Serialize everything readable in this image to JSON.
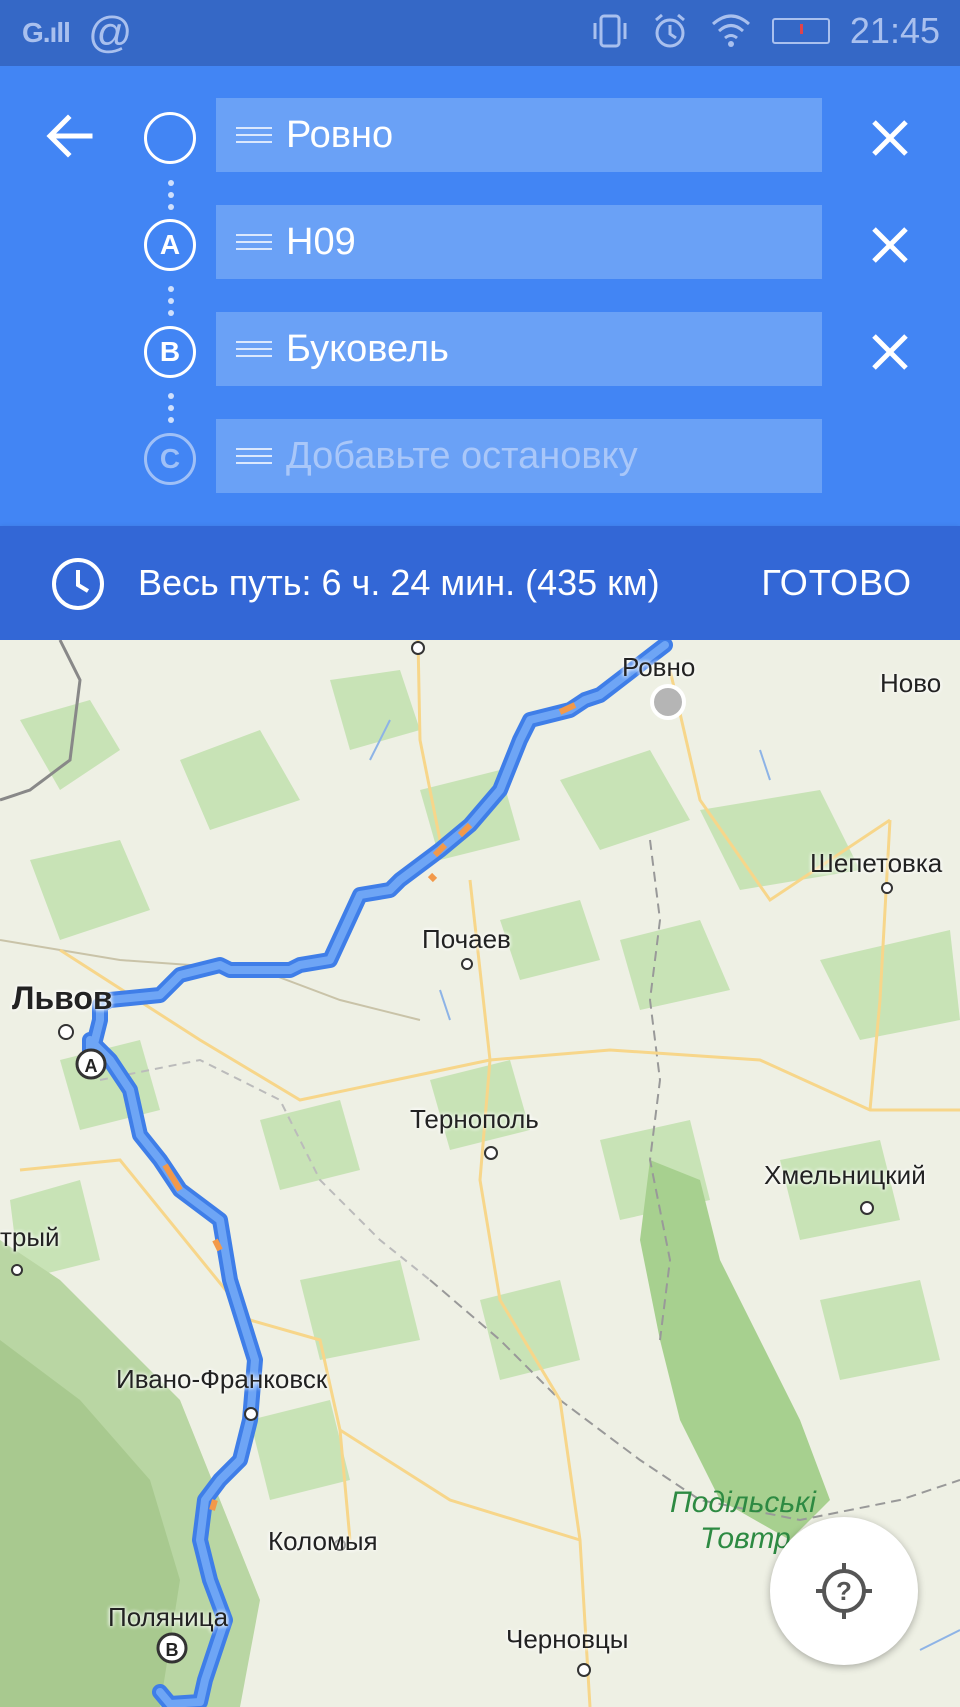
{
  "status_bar": {
    "signal": "G.ıll",
    "at_symbol": "@",
    "time": "21:45"
  },
  "route": {
    "stops": [
      {
        "marker": "",
        "value": "Ровно"
      },
      {
        "marker": "A",
        "value": "Н09"
      },
      {
        "marker": "B",
        "value": "Буковель"
      },
      {
        "marker": "C",
        "placeholder": "Добавьте остановку"
      }
    ]
  },
  "summary": {
    "text": "Весь путь: 6 ч. 24 мин.  (435 км)",
    "done_label": "ГОТОВО"
  },
  "map": {
    "cities": {
      "rovno": "Ровно",
      "novo": "Ново",
      "shepetovka": "Шепетовка",
      "pochaev": "Почаев",
      "lvov": "Львов",
      "ternopol": "Тернополь",
      "khmelnitsky": "Хмельницкий",
      "stryi": "трый",
      "ivano": "Ивано-Франковск",
      "kolomyya": "Коломыя",
      "polyanitsa": "Поляница",
      "chernovtsy": "Черновцы"
    },
    "region_line1": "Подільські",
    "region_line2": "Товтр",
    "markers": {
      "a": "A",
      "b": "B"
    },
    "route_color": "#4a89f3",
    "traffic_color": "#f2994a"
  },
  "icons": {
    "back": "arrow-left-icon",
    "close": "close-icon",
    "drag": "drag-handle-icon",
    "clock": "clock-icon",
    "locate": "locate-icon"
  }
}
